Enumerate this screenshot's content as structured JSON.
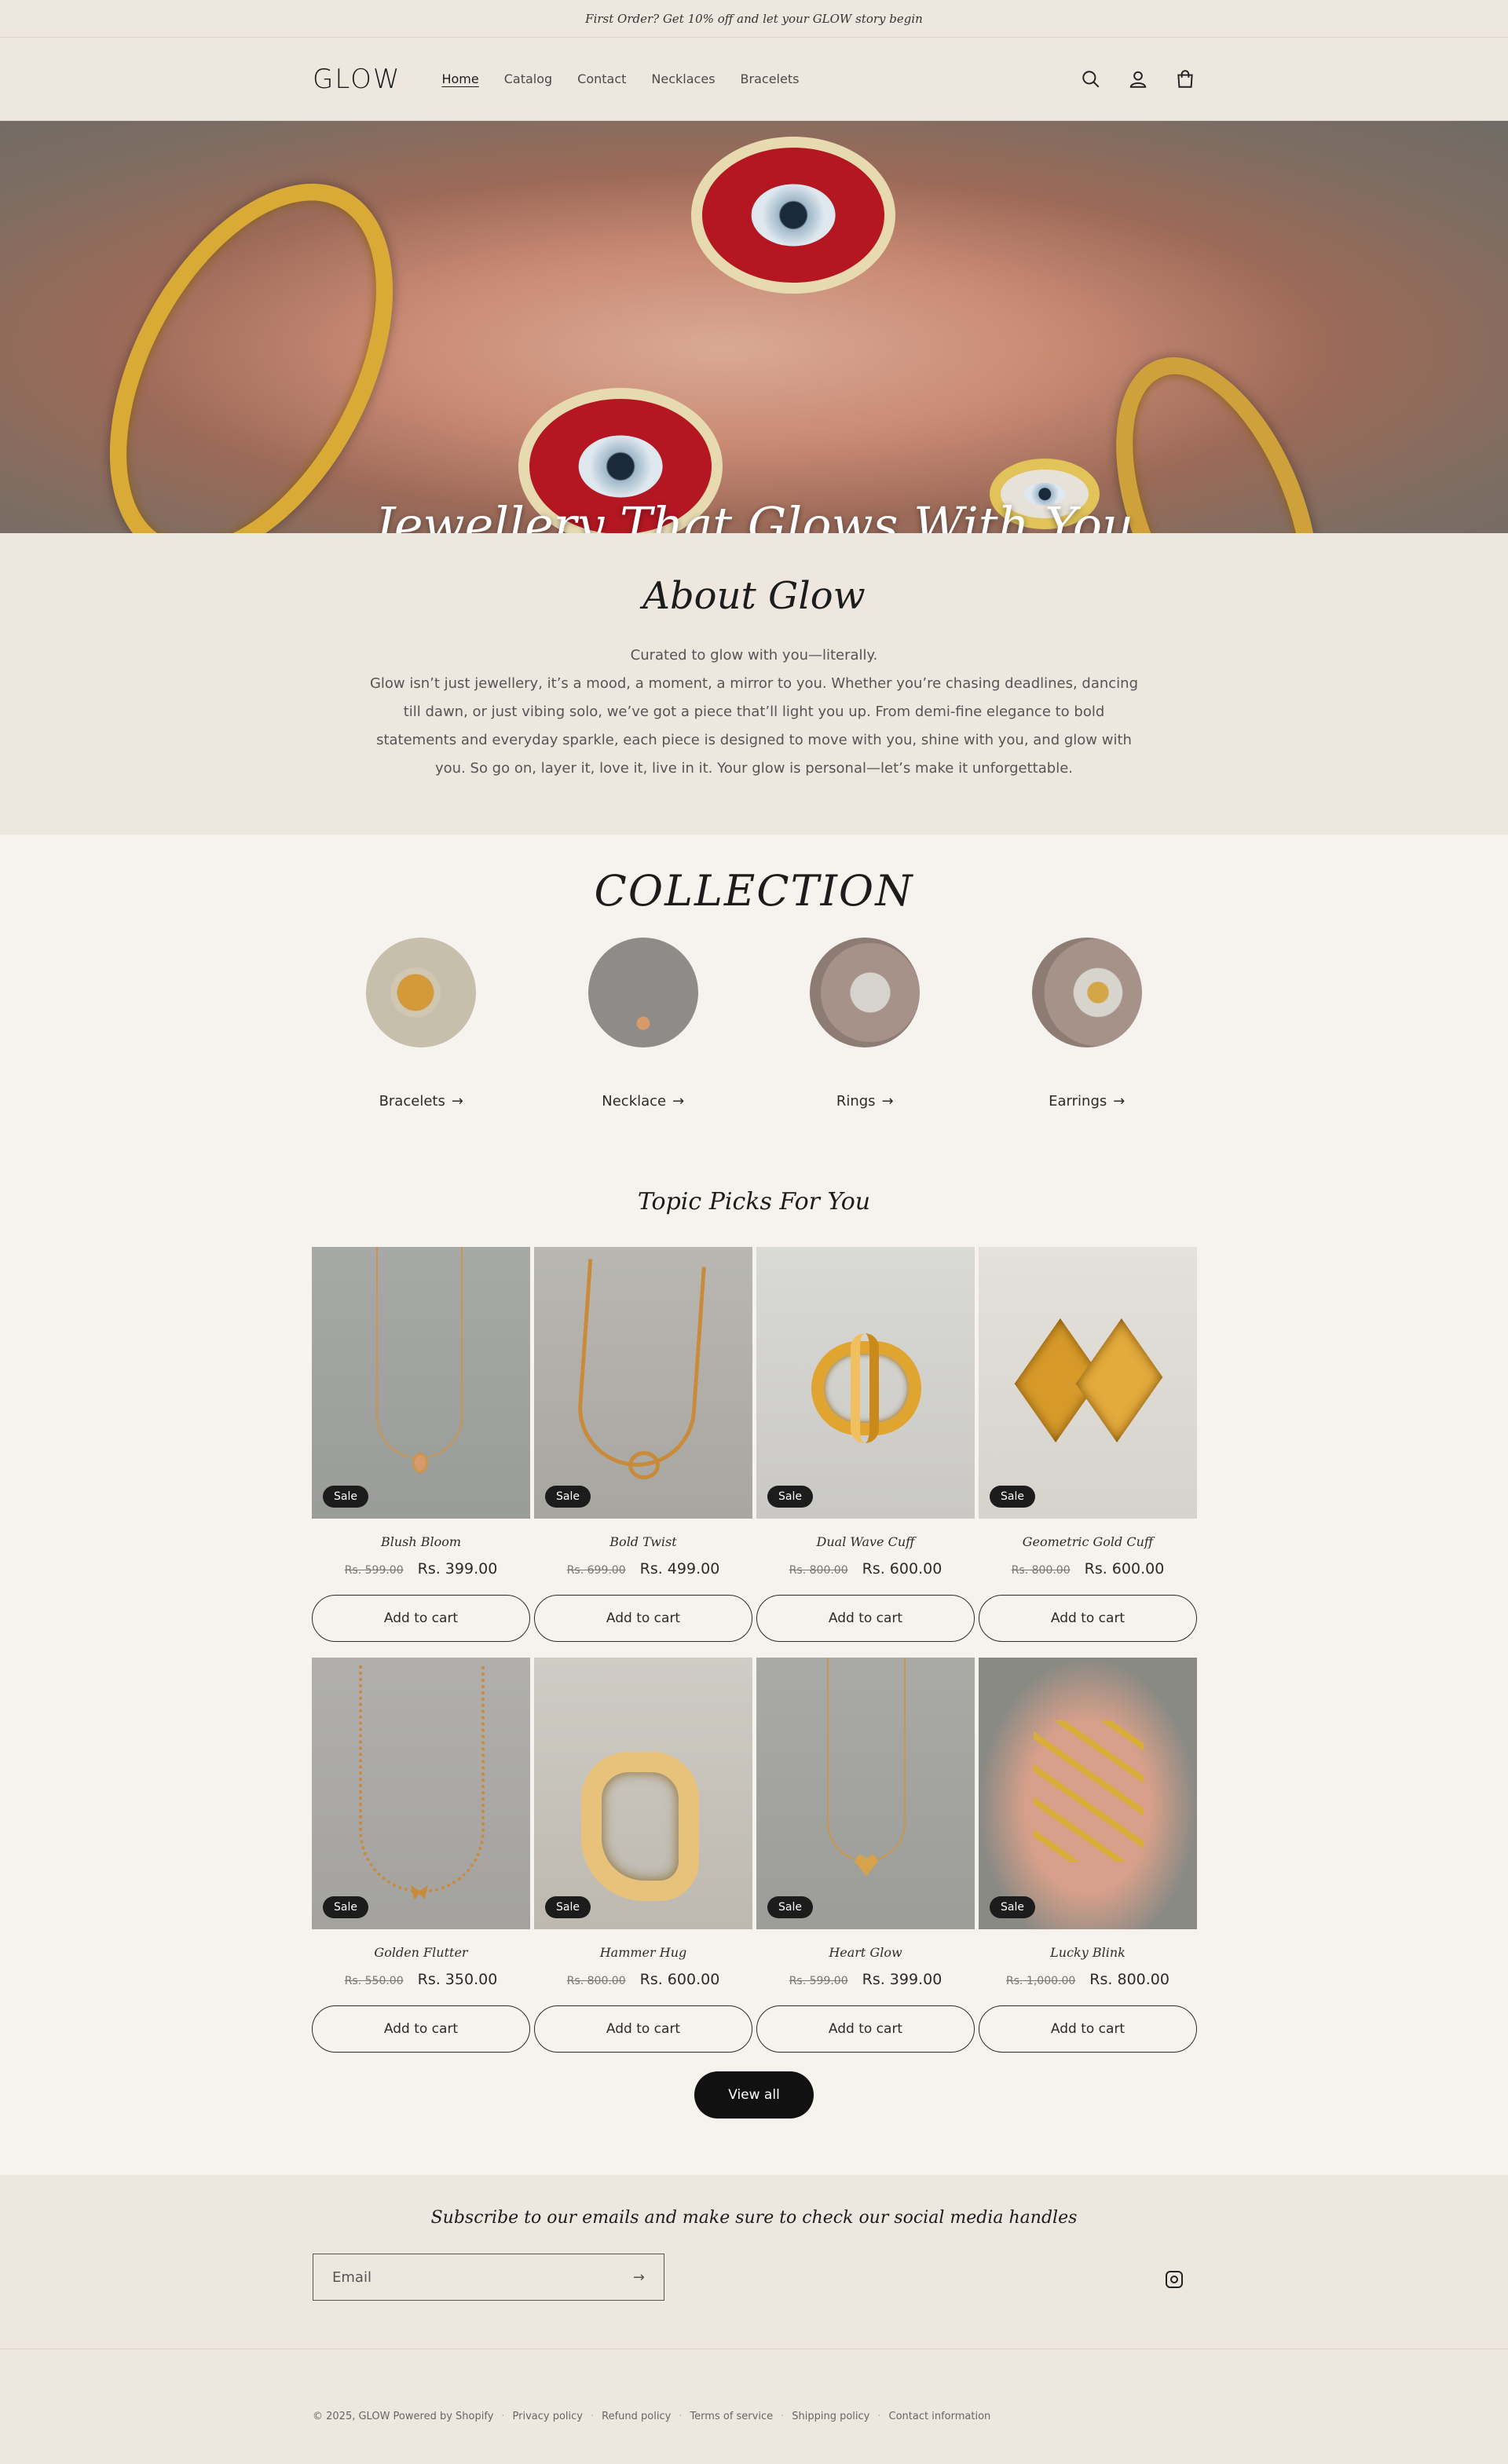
{
  "announcement": "First Order? Get 10% off and let your GLOW story begin",
  "header": {
    "logo": "GLOW",
    "nav": [
      "Home",
      "Catalog",
      "Contact",
      "Necklaces",
      "Bracelets"
    ],
    "icons": [
      "search-icon",
      "account-icon",
      "cart-icon"
    ]
  },
  "hero": {
    "title": "Jewellery That Glows With You"
  },
  "about": {
    "title": "About Glow",
    "tagline": "Curated to glow with you—literally.",
    "body": "Glow isn’t just jewellery, it’s a mood, a moment, a mirror to you. Whether you’re chasing deadlines, dancing till dawn, or just vibing solo, we’ve got a piece that’ll light you up. From demi-fine elegance to bold statements and everyday sparkle, each piece is designed to move with you, shine with you, and glow with you. So go on, layer it, love it, live in it. Your glow is personal—let’s make it unforgettable."
  },
  "collection": {
    "title": "COLLECTION",
    "items": [
      {
        "label": "Bracelets"
      },
      {
        "label": "Necklace"
      },
      {
        "label": "Rings"
      },
      {
        "label": "Earrings"
      }
    ]
  },
  "picks": {
    "title": "Topic Picks For You",
    "sale_label": "Sale",
    "cart_label": "Add to cart",
    "products": [
      {
        "name": "Blush Bloom",
        "old": "Rs. 599.00",
        "new": "Rs. 399.00"
      },
      {
        "name": "Bold Twist",
        "old": "Rs. 699.00",
        "new": "Rs. 499.00"
      },
      {
        "name": "Dual Wave Cuff",
        "old": "Rs. 800.00",
        "new": "Rs. 600.00"
      },
      {
        "name": "Geometric Gold Cuff",
        "old": "Rs. 800.00",
        "new": "Rs. 600.00"
      },
      {
        "name": "Golden Flutter",
        "old": "Rs. 550.00",
        "new": "Rs. 350.00"
      },
      {
        "name": "Hammer Hug",
        "old": "Rs. 800.00",
        "new": "Rs. 600.00"
      },
      {
        "name": "Heart Glow",
        "old": "Rs. 599.00",
        "new": "Rs. 399.00"
      },
      {
        "name": "Lucky Blink",
        "old": "Rs. 1,000.00",
        "new": "Rs. 800.00"
      }
    ],
    "view_all": "View all"
  },
  "newsletter": {
    "title": "Subscribe to our emails and make sure to check our social media handles",
    "placeholder": "Email"
  },
  "footer": {
    "copyright": "© 2025, GLOW Powered by Shopify",
    "links": [
      "Privacy policy",
      "Refund policy",
      "Terms of service",
      "Shipping policy",
      "Contact information"
    ]
  }
}
